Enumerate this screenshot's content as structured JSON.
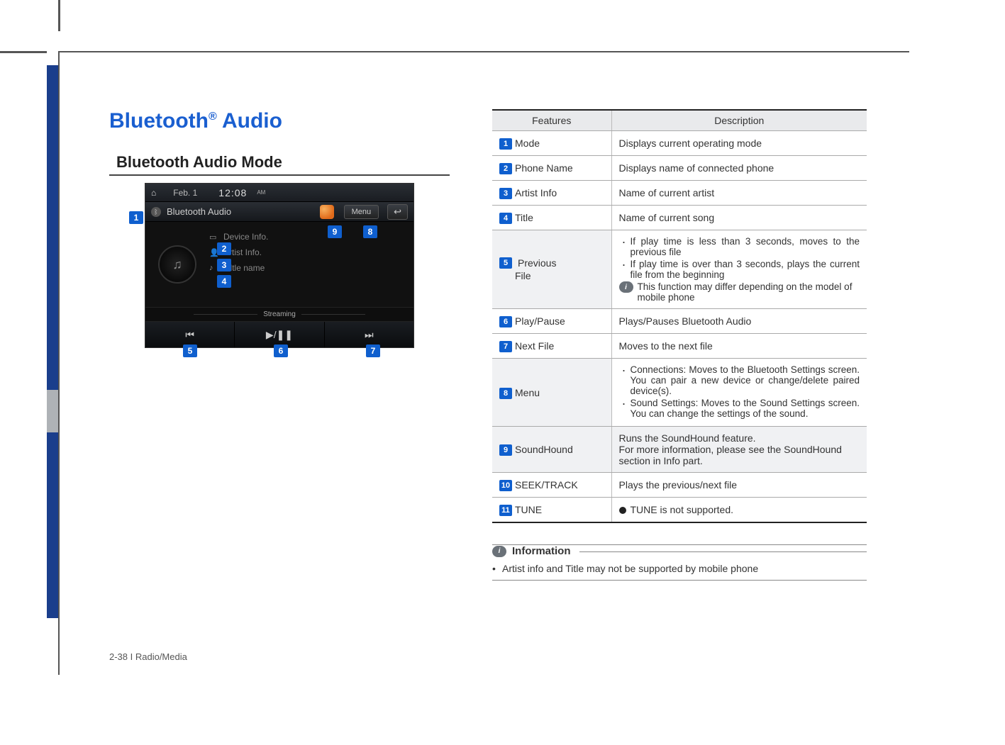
{
  "title_main": "Bluetooth",
  "title_suffix": " Audio",
  "title_reg": "®",
  "section_heading": "Bluetooth Audio Mode",
  "screenshot": {
    "date": "Feb.  1",
    "time": "12:08",
    "ampm": "AM",
    "mode_label": "Bluetooth Audio",
    "menu_label": "Menu",
    "back_glyph": "↩",
    "device_info": "Device Info.",
    "artist_info": "Artist Info.",
    "title_name": "Tiltle name",
    "streaming": "Streaming",
    "prev_glyph": "⏮",
    "play_glyph": "▶/❚❚",
    "next_glyph": "⏭",
    "home_glyph": "⌂",
    "bt_glyph": "ᛒ",
    "note_glyph": "♫",
    "device_ico": "▭",
    "artist_ico": "👤",
    "title_ico": "♪"
  },
  "callouts": {
    "c1": "1",
    "c2": "2",
    "c3": "3",
    "c4": "4",
    "c5": "5",
    "c6": "6",
    "c7": "7",
    "c8": "8",
    "c9": "9"
  },
  "table": {
    "head_features": "Features",
    "head_description": "Description",
    "rows": {
      "r1": {
        "n": "1",
        "label": "Mode",
        "desc": "Displays current operating mode"
      },
      "r2": {
        "n": "2",
        "label": "Phone Name",
        "desc": "Displays name of connected phone"
      },
      "r3": {
        "n": "3",
        "label": "Artist Info",
        "desc": "Name of current artist"
      },
      "r4": {
        "n": "4",
        "label": "Title",
        "desc": "Name of current song"
      },
      "r5": {
        "n": "5",
        "label_a": "Previous",
        "label_b": "File",
        "b1": "If play time is less than 3 seconds, moves to the previous file",
        "b2": "If play time is over than 3 seconds, plays the current file from the beginning",
        "note": "This function may differ depending on the model of mobile phone"
      },
      "r6": {
        "n": "6",
        "label": "Play/Pause",
        "desc": "Plays/Pauses Bluetooth Audio"
      },
      "r7": {
        "n": "7",
        "label": "Next File",
        "desc": "Moves to the next file"
      },
      "r8": {
        "n": "8",
        "label": "Menu",
        "b1": "Connections: Moves to the Bluetooth Settings screen. You can pair a new device or change/delete paired device(s).",
        "b2": "Sound Settings: Moves to the Sound Settings screen. You can change the settings of the sound."
      },
      "r9": {
        "n": "9",
        "label": "SoundHound",
        "d1": "Runs the SoundHound feature.",
        "d2": "For more information, please see the SoundHound section in Info part."
      },
      "r10": {
        "n": "10",
        "label": "SEEK/TRACK",
        "desc": "Plays the previous/next file"
      },
      "r11": {
        "n": "11",
        "label": "TUNE",
        "desc": "TUNE is not supported."
      }
    }
  },
  "info": {
    "heading": "Information",
    "bullet": "Artist info and Title may not be supported by mobile phone",
    "iglyph": "i"
  },
  "page_number": "2-38 I Radio/Media"
}
